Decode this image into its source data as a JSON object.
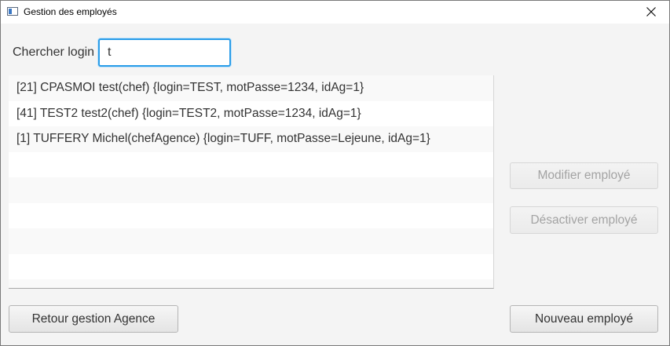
{
  "window": {
    "title": "Gestion des employés"
  },
  "search": {
    "label": "Chercher login",
    "value": "t"
  },
  "employees": [
    "[21]  CPASMOI test(chef)  {login=TEST, motPasse=1234, idAg=1}",
    "[41]  TEST2 test2(chef)  {login=TEST2, motPasse=1234, idAg=1}",
    "[1]  TUFFERY Michel(chefAgence)  {login=TUFF, motPasse=Lejeune, idAg=1}",
    "",
    "",
    "",
    "",
    "",
    ""
  ],
  "buttons": {
    "modifier": "Modifier employé",
    "desactiver": "Désactiver employé",
    "retour": "Retour gestion Agence",
    "nouveau": "Nouveau employé"
  },
  "colors": {
    "focus_border": "#2b9de8",
    "window_background": "#f4f4f4"
  }
}
